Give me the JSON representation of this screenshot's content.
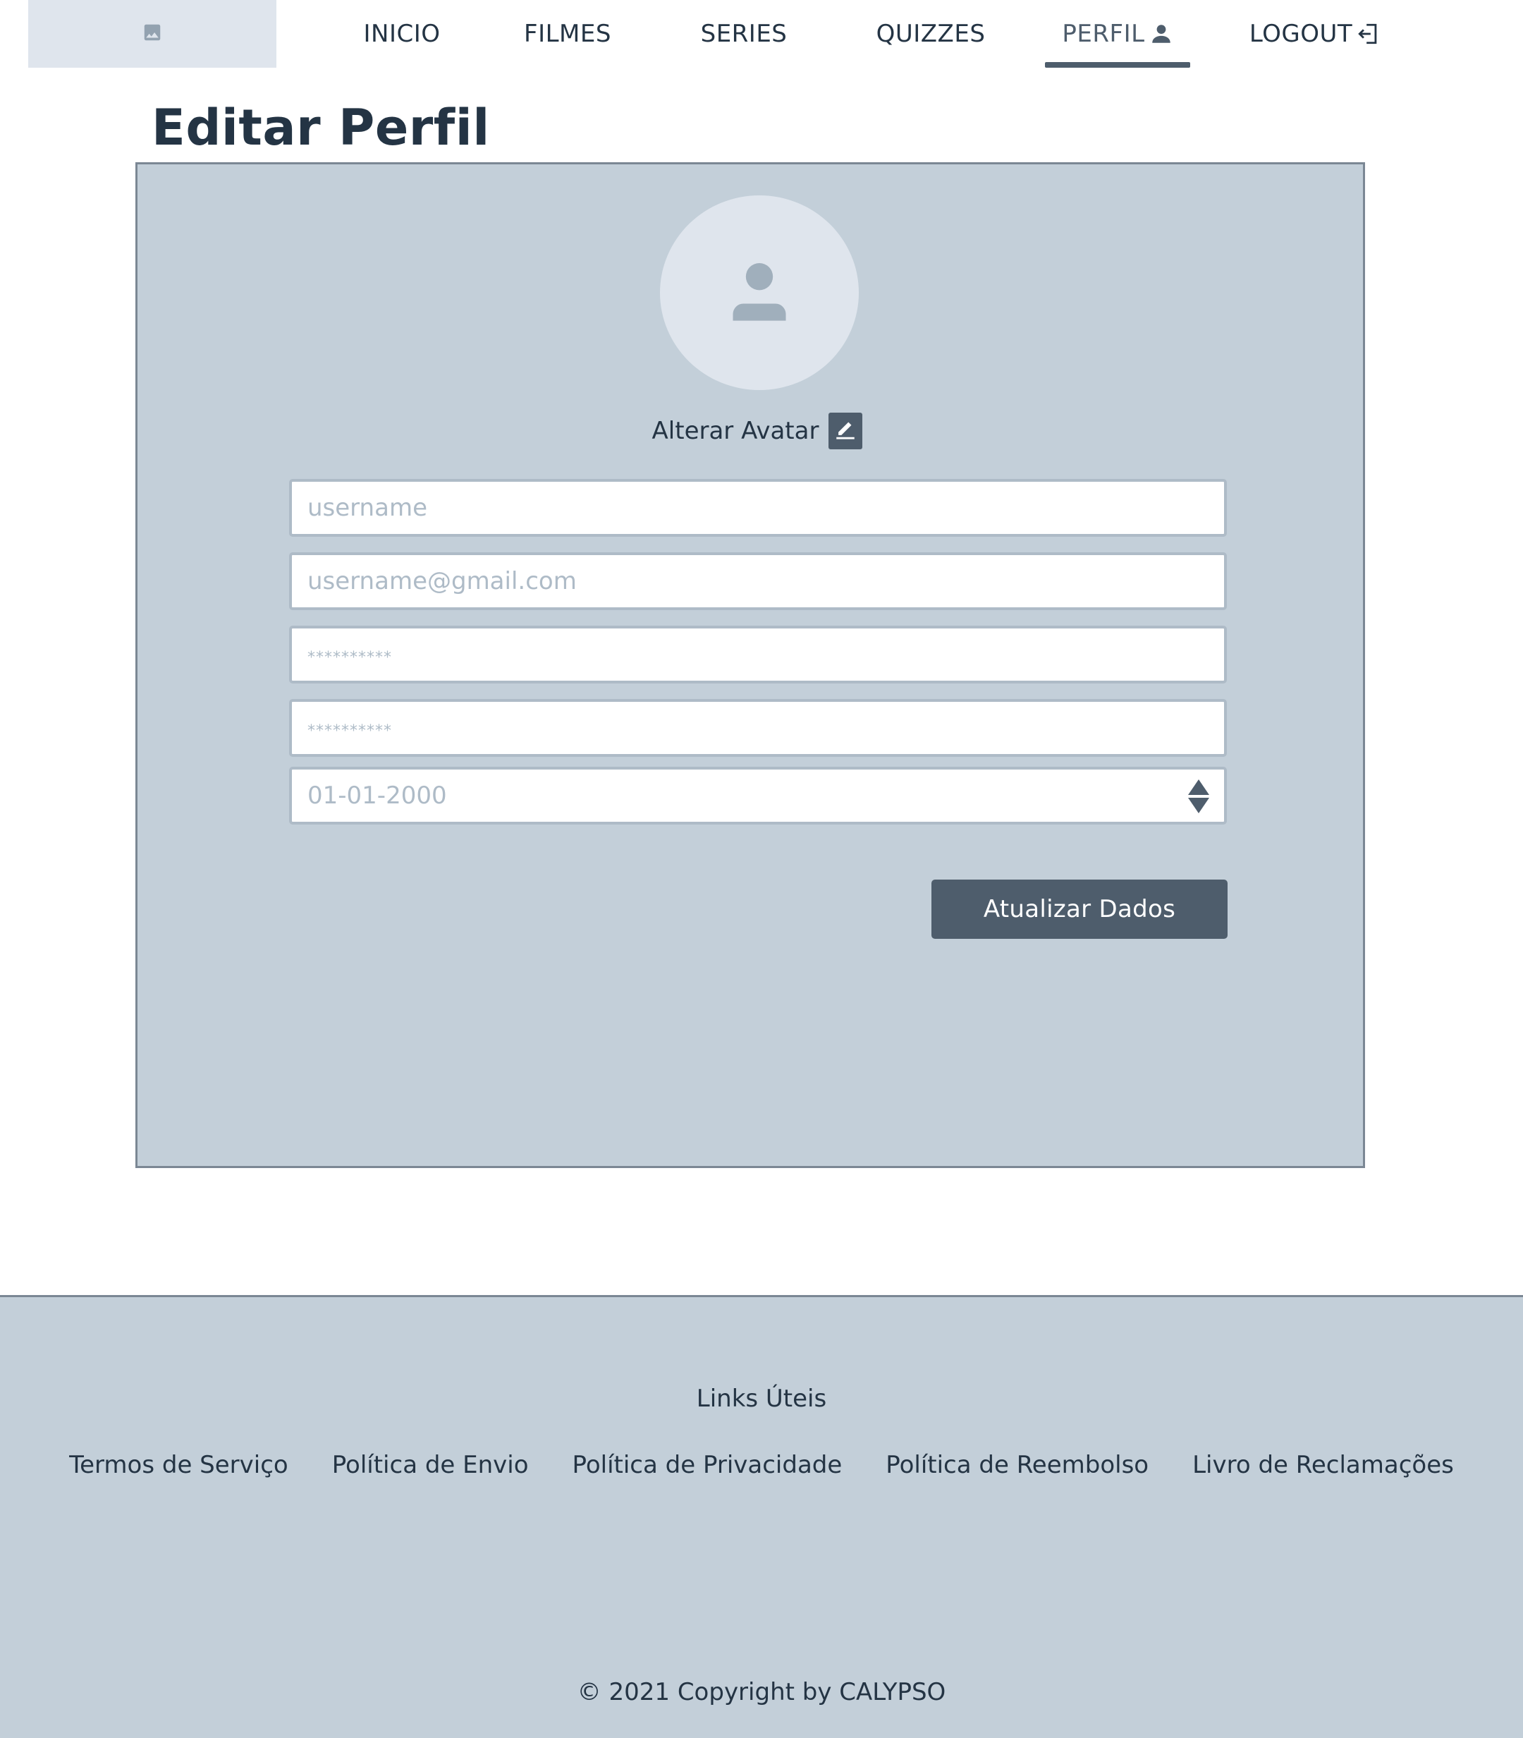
{
  "header": {
    "logo_icon": "image-placeholder-icon",
    "nav": [
      {
        "label": "INICIO",
        "active": false
      },
      {
        "label": "FILMES",
        "active": false
      },
      {
        "label": "SERIES",
        "active": false
      },
      {
        "label": "QUIZZES",
        "active": false
      },
      {
        "label": "PERFIL",
        "active": true,
        "icon": "user-icon"
      },
      {
        "label": "LOGOUT",
        "active": false,
        "icon": "logout-icon"
      }
    ]
  },
  "page": {
    "title": "Editar Perfil"
  },
  "profile_form": {
    "avatar_icon": "user-avatar-icon",
    "change_avatar_label": "Alterar Avatar",
    "change_avatar_icon": "pencil-icon",
    "fields": {
      "username": {
        "value": "",
        "placeholder": "username"
      },
      "email": {
        "value": "",
        "placeholder": "username@gmail.com"
      },
      "password": {
        "value": "",
        "placeholder": "**********"
      },
      "password_confirm": {
        "value": "",
        "placeholder": "**********"
      },
      "birthdate": {
        "value": "",
        "placeholder": "01-01-2000",
        "icon": "spinner-arrows-icon"
      }
    },
    "submit_label": "Atualizar Dados"
  },
  "footer": {
    "heading": "Links Úteis",
    "links": [
      "Termos de Serviço",
      "Política de Envio",
      "Política de Privacidade",
      "Política de Reembolso",
      "Livro de Reclamações"
    ],
    "copyright": "© 2021 Copyright by CALYPSO"
  },
  "colors": {
    "panel_bg": "#c3cfd9",
    "primary": "#4e5d6c",
    "text": "#243444",
    "logo_bg": "#dfe5ed"
  }
}
